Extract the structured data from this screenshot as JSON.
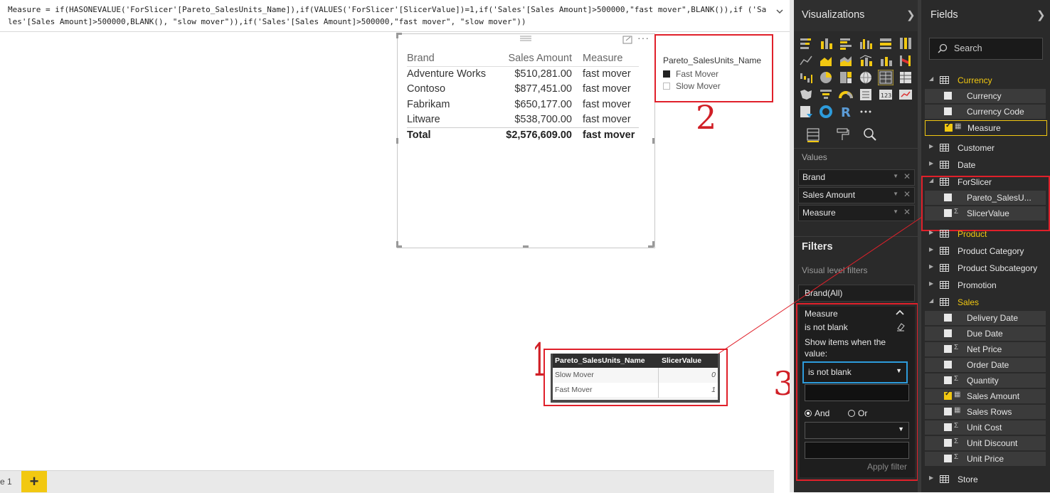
{
  "formula": {
    "text": "Measure = if(HASONEVALUE('ForSlicer'[Pareto_SalesUnits_Name]),if(VALUES('ForSlicer'[SlicerValue])=1,if('Sales'[Sales Amount]>500000,\"fast mover\",BLANK()),if ('Sales'[Sales Amount]>500000,BLANK(), \"slow mover\")),if('Sales'[Sales Amount]>500000,\"fast mover\", \"slow mover\"))"
  },
  "canvas": {
    "page_label": "e 1",
    "add_page": "+"
  },
  "table_visual": {
    "headers": [
      "Brand",
      "Sales Amount",
      "Measure"
    ],
    "rows": [
      [
        "Adventure Works",
        "$510,281.00",
        "fast mover"
      ],
      [
        "Contoso",
        "$877,451.00",
        "fast mover"
      ],
      [
        "Fabrikam",
        "$650,177.00",
        "fast mover"
      ],
      [
        "Litware",
        "$538,700.00",
        "fast mover"
      ]
    ],
    "total": [
      "Total",
      "$2,576,609.00",
      "fast mover"
    ]
  },
  "slicer_visual": {
    "title": "Pareto_SalesUnits_Name",
    "items": [
      {
        "label": "Fast Mover",
        "selected": true
      },
      {
        "label": "Slow Mover",
        "selected": false
      }
    ]
  },
  "data_table": {
    "headers": [
      "Pareto_SalesUnits_Name",
      "SlicerValue"
    ],
    "rows": [
      [
        "Slow Mover",
        "0"
      ],
      [
        "Fast Mover",
        "1"
      ]
    ]
  },
  "annotations": {
    "one": "1",
    "two": "2",
    "three": "3"
  },
  "visualizations": {
    "title": "Visualizations",
    "values_label": "Values",
    "value_wells": [
      "Brand",
      "Sales Amount",
      "Measure"
    ]
  },
  "filters": {
    "title": "Filters",
    "visual_level_label": "Visual level filters",
    "brand_filter": "Brand(All)",
    "measure_filter": {
      "name": "Measure",
      "state": "is not blank",
      "show_items_label": "Show items when the value:",
      "condition": "is not blank",
      "and_label": "And",
      "or_label": "Or",
      "apply_label": "Apply filter"
    }
  },
  "fields": {
    "title": "Fields",
    "search_placeholder": "Search",
    "tables": [
      {
        "name": "Currency",
        "expanded": true,
        "highlight": true,
        "fields": [
          {
            "name": "Currency",
            "checked": false,
            "type": ""
          },
          {
            "name": "Currency Code",
            "checked": false,
            "type": ""
          },
          {
            "name": "Measure",
            "checked": true,
            "type": "calc"
          }
        ]
      },
      {
        "name": "Customer",
        "expanded": false,
        "highlight": false,
        "fields": []
      },
      {
        "name": "Date",
        "expanded": false,
        "highlight": false,
        "fields": []
      },
      {
        "name": "ForSlicer",
        "expanded": true,
        "highlight": false,
        "fields": [
          {
            "name": "Pareto_SalesU...",
            "checked": false,
            "type": ""
          },
          {
            "name": "SlicerValue",
            "checked": false,
            "type": "sigma"
          }
        ]
      },
      {
        "name": "Product",
        "expanded": false,
        "highlight": true,
        "fields": []
      },
      {
        "name": "Product Category",
        "expanded": false,
        "highlight": false,
        "fields": []
      },
      {
        "name": "Product Subcategory",
        "expanded": false,
        "highlight": false,
        "fields": []
      },
      {
        "name": "Promotion",
        "expanded": false,
        "highlight": false,
        "fields": []
      },
      {
        "name": "Sales",
        "expanded": true,
        "highlight": true,
        "fields": [
          {
            "name": "Delivery Date",
            "checked": false,
            "type": ""
          },
          {
            "name": "Due Date",
            "checked": false,
            "type": ""
          },
          {
            "name": "Net Price",
            "checked": false,
            "type": "sigma"
          },
          {
            "name": "Order Date",
            "checked": false,
            "type": ""
          },
          {
            "name": "Quantity",
            "checked": false,
            "type": "sigma"
          },
          {
            "name": "Sales Amount",
            "checked": true,
            "type": "calc"
          },
          {
            "name": "Sales Rows",
            "checked": false,
            "type": "calc"
          },
          {
            "name": "Unit Cost",
            "checked": false,
            "type": "sigma"
          },
          {
            "name": "Unit Discount",
            "checked": false,
            "type": "sigma"
          },
          {
            "name": "Unit Price",
            "checked": false,
            "type": "sigma"
          }
        ]
      },
      {
        "name": "Store",
        "expanded": false,
        "highlight": false,
        "fields": []
      }
    ]
  },
  "colors": {
    "accent": "#f2c811",
    "annotation_red": "#e0202a",
    "pane_bg": "#2a2a2a",
    "select_border": "#2d9bdb"
  }
}
